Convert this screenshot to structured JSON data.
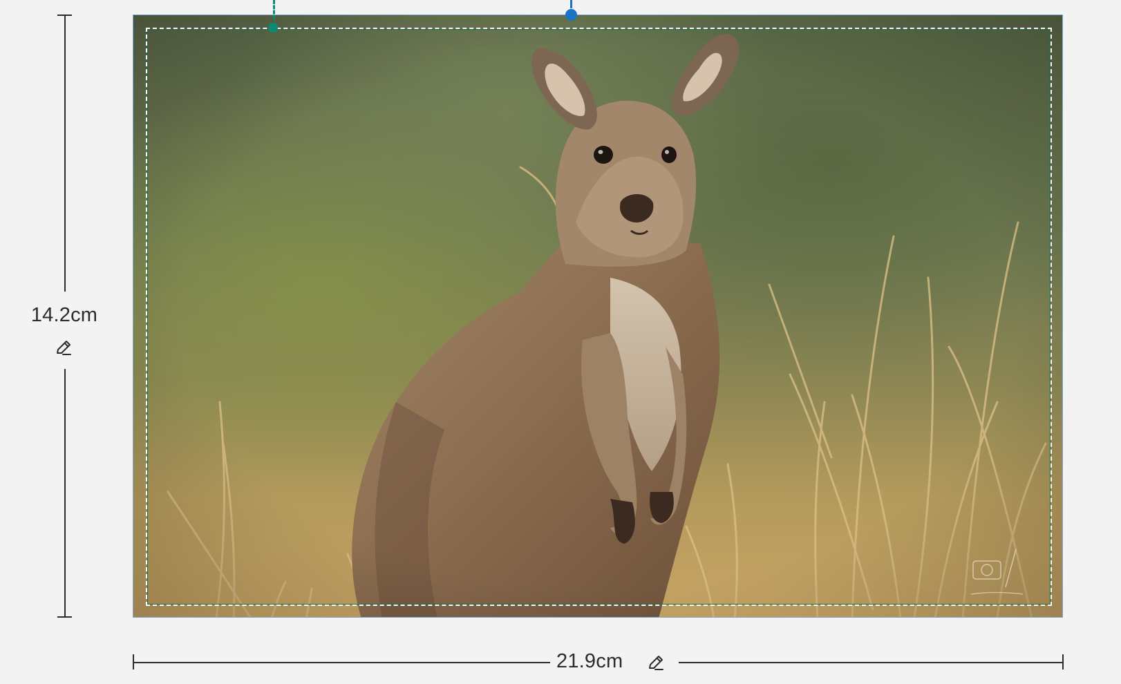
{
  "dimensions": {
    "height_label": "14.2cm",
    "width_label": "21.9cm"
  },
  "image": {
    "subject": "kangaroo-photo"
  },
  "colors": {
    "guide_green": "#0d8a70",
    "handle_blue": "#1a73c4",
    "frame_border": "#7fa6cf",
    "ruler": "#2b2b2b",
    "background": "#f3f3f3"
  },
  "icons": {
    "edit": "pencil-icon",
    "watermark": "camera-logo-watermark"
  }
}
